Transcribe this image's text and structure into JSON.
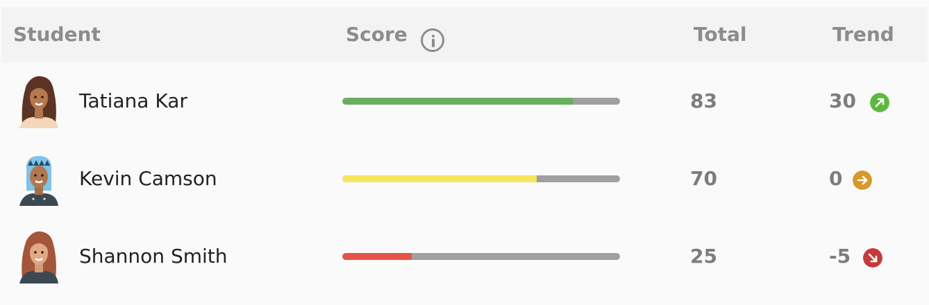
{
  "header": {
    "student": "Student",
    "score": "Score",
    "total": "Total",
    "trend": "Trend"
  },
  "rows": [
    {
      "name": "Tatiana Kar",
      "score": 83,
      "score_color": "#6aae5f",
      "total": "83",
      "trend": "30",
      "trend_dir": "up",
      "trend_color": "#5cb83f"
    },
    {
      "name": "Kevin Camson",
      "score": 70,
      "score_color": "#f5e65e",
      "total": "70",
      "trend": "0",
      "trend_dir": "flat",
      "trend_color": "#d69a2a"
    },
    {
      "name": "Shannon Smith",
      "score": 25,
      "score_color": "#e45547",
      "total": "25",
      "trend": "-5",
      "trend_dir": "down",
      "trend_color": "#c43a3a"
    }
  ],
  "colors": {
    "track": "#a0a0a0",
    "header_bg": "#f3f3f3",
    "header_text": "#8c8c8c"
  },
  "icons": {
    "info": "info-icon",
    "up": "trend-up-icon",
    "flat": "trend-flat-icon",
    "down": "trend-down-icon"
  }
}
